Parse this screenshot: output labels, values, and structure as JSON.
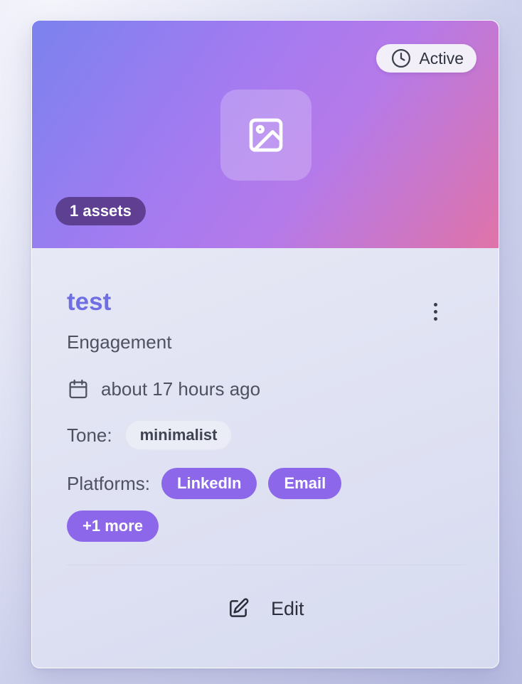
{
  "card": {
    "status": {
      "label": "Active",
      "icon": "clock-icon"
    },
    "media": {
      "icon": "image-icon"
    },
    "assets_badge": "1 assets",
    "title": "test",
    "menu_icon": "more-vertical-icon",
    "subtitle": "Engagement",
    "date": {
      "icon": "calendar-icon",
      "text": "about 17 hours ago"
    },
    "tone": {
      "label": "Tone:",
      "value": "minimalist"
    },
    "platforms": {
      "label": "Platforms:",
      "items": [
        "LinkedIn",
        "Email"
      ],
      "more": "+1 more"
    },
    "actions": {
      "edit_label": "Edit",
      "edit_icon": "edit-icon"
    }
  },
  "colors": {
    "accent": "#8d67ea",
    "title": "#6f6fe3",
    "hero_gradient": [
      "#7b82ee",
      "#a37bf1",
      "#e073a8"
    ]
  }
}
